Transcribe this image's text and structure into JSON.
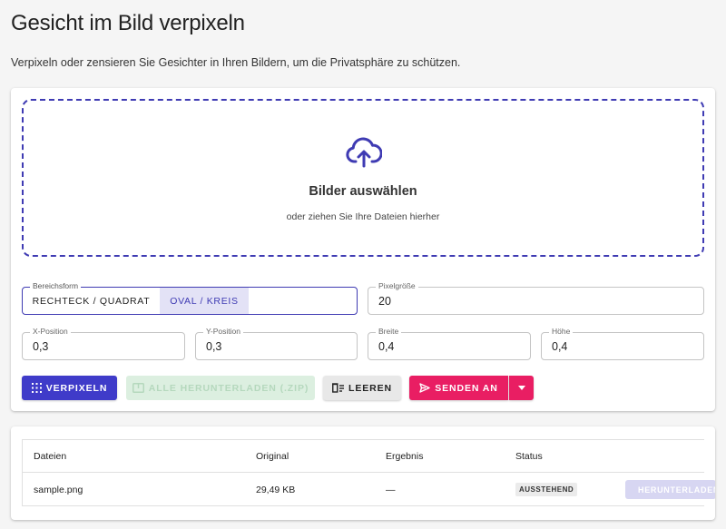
{
  "page": {
    "title": "Gesicht im Bild verpixeln",
    "subtitle": "Verpixeln oder zensieren Sie Gesichter in Ihren Bildern, um die Privatsphäre zu schützen."
  },
  "dropzone": {
    "icon": "cloud-upload-icon",
    "title": "Bilder auswählen",
    "subtitle": "oder ziehen Sie Ihre Dateien hierher"
  },
  "form": {
    "shape": {
      "label": "Bereichsform",
      "options": [
        "RECHTECK / QUADRAT",
        "OVAL / KREIS"
      ],
      "selected": "OVAL / KREIS"
    },
    "pixel_size": {
      "label": "Pixelgröße",
      "value": "20"
    },
    "x_position": {
      "label": "X-Position",
      "value": "0,3"
    },
    "y_position": {
      "label": "Y-Position",
      "value": "0,3"
    },
    "width": {
      "label": "Breite",
      "value": "0,4"
    },
    "height": {
      "label": "Höhe",
      "value": "0,4"
    }
  },
  "actions": {
    "pixelate": "VERPIXELN",
    "download_all": "ALLE HERUNTERLADEN (.ZIP)",
    "clear": "LEEREN",
    "send_to": "SENDEN AN"
  },
  "colors": {
    "primary": "#3f3bc9",
    "accent": "#e91e63",
    "disabled_green": "#dcefe0"
  },
  "table": {
    "headers": [
      "Dateien",
      "Original",
      "Ergebnis",
      "Status"
    ],
    "rows": [
      {
        "file": "sample.png",
        "original": "29,49 KB",
        "result": "—",
        "status": "AUSSTEHEND",
        "action": "HERUNTERLADEN"
      }
    ]
  }
}
